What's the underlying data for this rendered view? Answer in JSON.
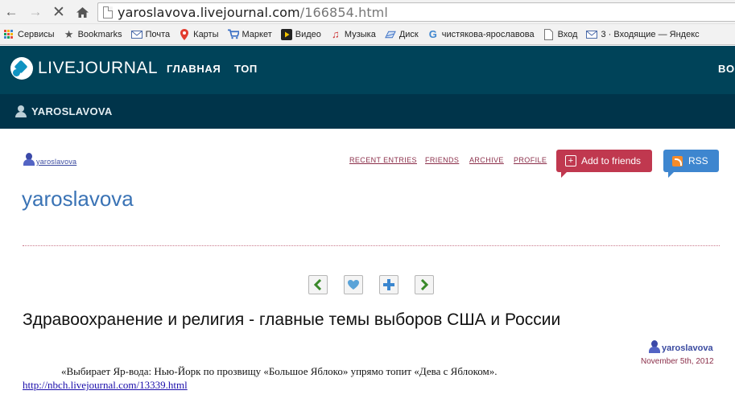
{
  "browser": {
    "url_host": "yaroslavova.livejournal.com",
    "url_path": "/166854.html",
    "bookmarks": [
      {
        "label": "Сервисы",
        "icon": "apps-grid-icon"
      },
      {
        "label": "Bookmarks",
        "icon": "star-icon"
      },
      {
        "label": "Почта",
        "icon": "mail-icon"
      },
      {
        "label": "Карты",
        "icon": "map-pin-icon"
      },
      {
        "label": "Маркет",
        "icon": "cart-icon"
      },
      {
        "label": "Видео",
        "icon": "video-icon"
      },
      {
        "label": "Музыка",
        "icon": "music-icon"
      },
      {
        "label": "Диск",
        "icon": "disk-icon"
      },
      {
        "label": "чистякова-ярославова",
        "icon": "google-icon"
      },
      {
        "label": "Вход",
        "icon": "page-icon"
      },
      {
        "label": "3 · Входящие — Яндекс",
        "icon": "mail-icon"
      }
    ]
  },
  "lj_header": {
    "logo_text": "LIVEJOURNAL",
    "nav": [
      "ГЛАВНАЯ",
      "ТОП"
    ],
    "right_nav_fragment": "BO",
    "user_bar_name": "YAROSLAVOVA"
  },
  "journal": {
    "username": "yaroslavova",
    "title": "yaroslavova",
    "menu": [
      "RECENT ENTRIES",
      "FRIENDS",
      "ARCHIVE",
      "PROFILE"
    ],
    "add_friends_label": "Add to friends",
    "rss_label": "RSS"
  },
  "entry": {
    "title": "Здравоохранение и религия - главные темы выборов США и России",
    "author": "yaroslavova",
    "date": "November 5th, 2012",
    "body": "«Выбирает Яр-вода: Нью-Йорк по прозвищу «Большое Яблоко» упрямо топит «Дева с Яблоком».",
    "link": "http://nbch.livejournal.com/13339.html"
  },
  "colors": {
    "lj_header": "#004359",
    "lj_user_bar": "#00344a",
    "journal_title": "#3a73b5",
    "menu_link": "#8b2f4a",
    "add_friends_button": "#c0384f",
    "rss_button": "#3e86cf"
  }
}
